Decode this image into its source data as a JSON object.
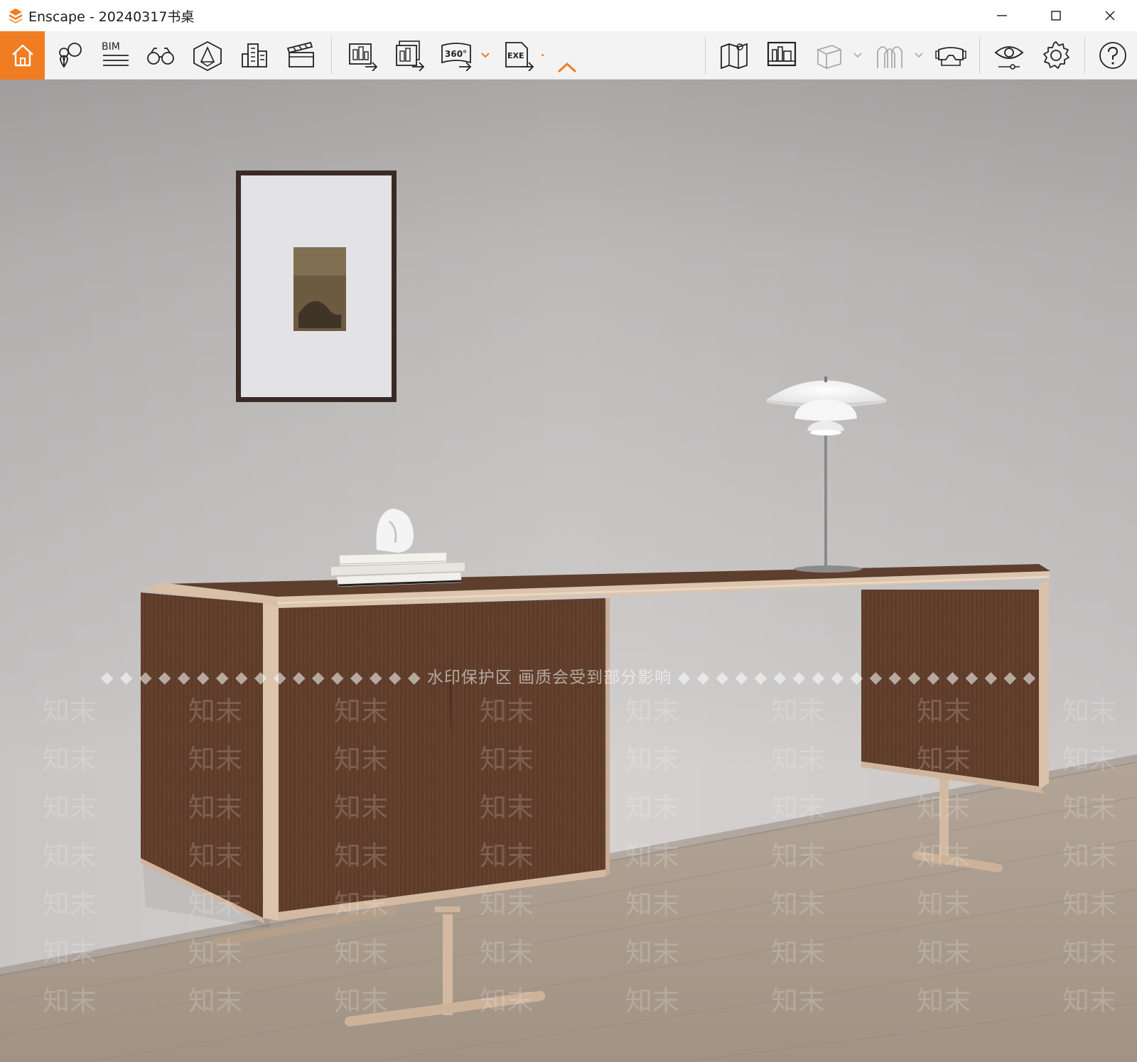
{
  "window": {
    "title": "Enscape - 20240317书桌",
    "controls": {
      "minimize_icon": "minimize-icon",
      "maximize_icon": "maximize-icon",
      "close_icon": "close-icon"
    }
  },
  "toolbar": {
    "accent_color": "#f07d22",
    "bim_label": "BIM",
    "export_360_label": "360°",
    "exe_label": "EXE",
    "groups": [
      [
        "home-icon",
        "place-marker-icon",
        "bim-icon",
        "binoculars-icon",
        "perspective-icon",
        "buildings-icon",
        "clapperboard-icon"
      ],
      [
        "screenshot-export-icon",
        "batch-export-icon",
        "panorama-export-icon",
        "exe-export-icon",
        "collapse-icon"
      ],
      [
        "map-icon",
        "gallery-icon",
        "cube-icon",
        "arches-icon",
        "vr-headset-icon"
      ],
      [
        "visual-settings-icon",
        "settings-gear-icon",
        "help-icon"
      ]
    ]
  },
  "viewport": {
    "watermark": "水印保护区  画质会受到部分影响",
    "watermark_logo": "知末"
  }
}
